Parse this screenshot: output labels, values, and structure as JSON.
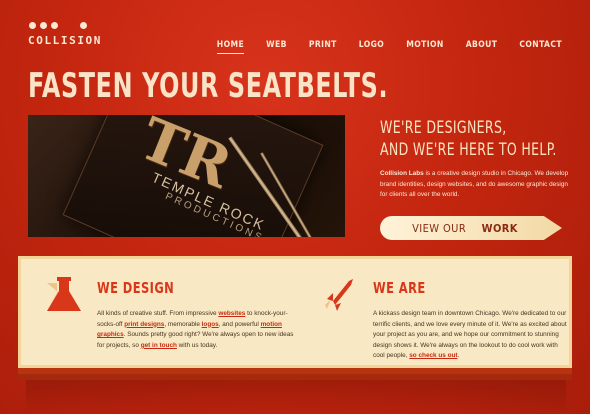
{
  "brand": {
    "name": "COLLISION"
  },
  "nav": {
    "items": [
      {
        "label": "HOME",
        "active": true
      },
      {
        "label": "WEB"
      },
      {
        "label": "PRINT"
      },
      {
        "label": "LOGO"
      },
      {
        "label": "MOTION"
      },
      {
        "label": "ABOUT"
      },
      {
        "label": "CONTACT"
      }
    ]
  },
  "hero": {
    "headline": "FASTEN YOUR SEATBELTS.",
    "photo": {
      "text_line1": "TEMPLE ROCK",
      "text_line2": "PRODUCTIONS"
    }
  },
  "intro": {
    "title_line1": "WE'RE DESIGNERS,",
    "title_line2": "AND WE'RE HERE TO HELP.",
    "company": "Collision Labs",
    "body": " is a creative design studio in Chicago. We develop brand identities, design websites, and do awesome graphic design for clients all over the world.",
    "cta_prefix": "VIEW OUR ",
    "cta_bold": "WORK"
  },
  "design": {
    "title": "WE DESIGN",
    "t1": "All kinds of creative stuff. From impressive ",
    "l1": "websites",
    "t2": " to knock-your-socks-off ",
    "l2": "print designs",
    "t3": ", memorable ",
    "l3": "logos",
    "t4": ", and powerful ",
    "l4": "motion graphics",
    "t5": ". Sounds pretty good right? We're always open to new ideas for projects, so ",
    "l5": "get in touch",
    "t6": " with us today."
  },
  "weare": {
    "title": "WE ARE",
    "t1": "A kickass design team in downtown Chicago. We're dedicated to our terrific clients, and we love every minute of it. We're as excited about your project as you are, and we hope our commitment to stunning design shows it. We're always on the lookout to do cool work with cool people, ",
    "l1": "so check us out",
    "t2": "."
  },
  "colors": {
    "background": "#c4260f",
    "cream": "#f8e9c4",
    "accent": "#d9371a",
    "heading_text": "#f9e4c8"
  },
  "icons": {
    "design": "flask-icon",
    "weare": "rocket-icon"
  }
}
